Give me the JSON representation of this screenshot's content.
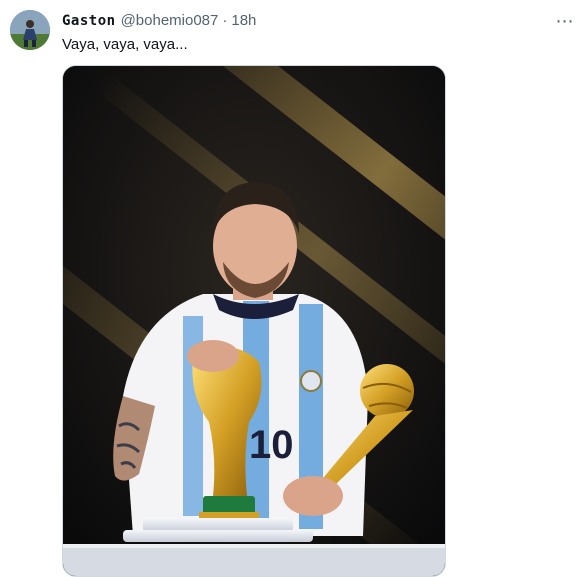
{
  "tweet": {
    "display_name": "Gaston",
    "handle": "@bohemio087",
    "separator": "·",
    "timestamp": "18h",
    "text": "Vaya, vaya, vaya...",
    "more_icon": "more-horizontal-icon"
  },
  "media": {
    "jersey_number": "10"
  },
  "colors": {
    "text_primary": "#0f1419",
    "text_secondary": "#536471",
    "media_border": "#cfd9de"
  }
}
